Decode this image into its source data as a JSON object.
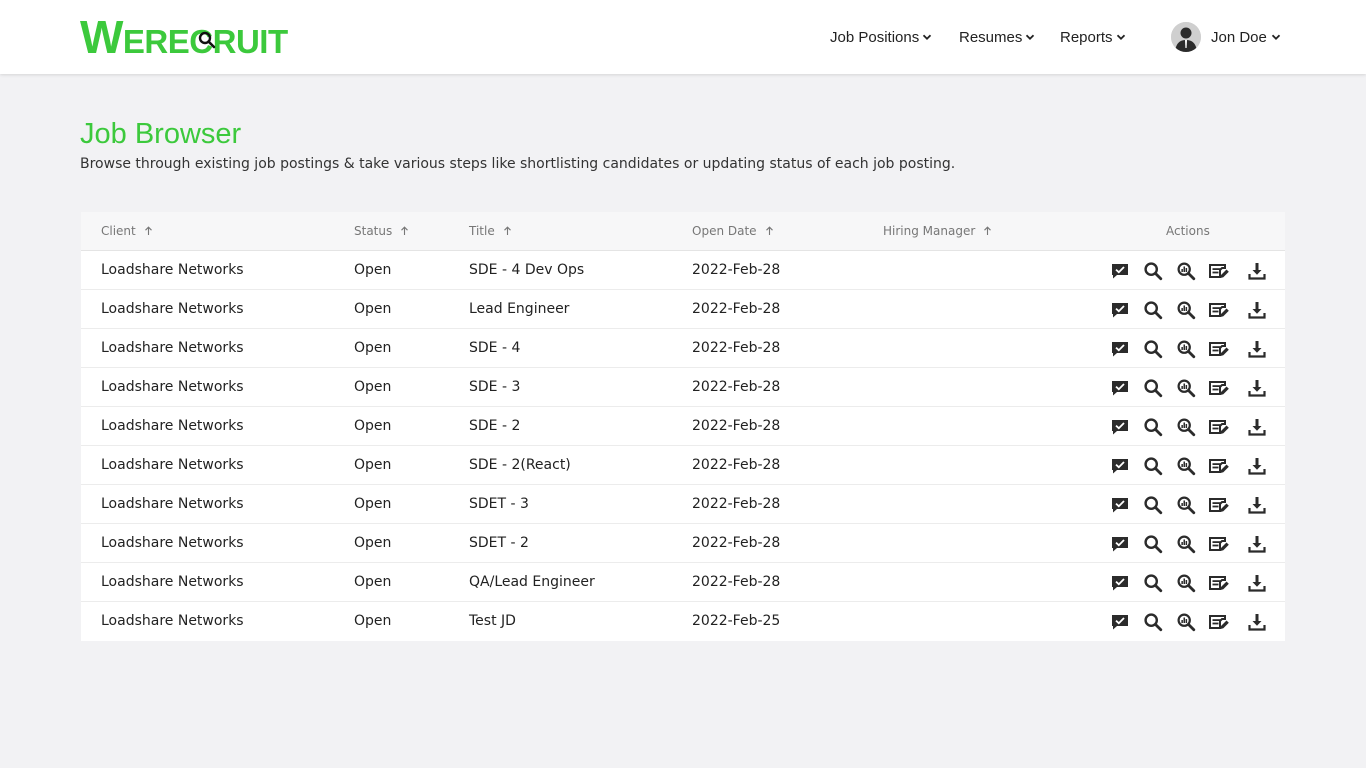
{
  "brand": {
    "logo_text": "WERECRUIT",
    "accent_color": "#3cc93c"
  },
  "nav": {
    "job_positions": "Job Positions",
    "resumes": "Resumes",
    "reports": "Reports"
  },
  "user": {
    "name": "Jon Doe"
  },
  "page": {
    "title": "Job Browser",
    "subtitle": "Browse through existing job postings & take various steps like shortlisting candidates or updating status of each job posting."
  },
  "table": {
    "headers": {
      "client": "Client",
      "status": "Status",
      "title": "Title",
      "open_date": "Open Date",
      "hiring_manager": "Hiring Manager",
      "actions": "Actions"
    },
    "action_icons": [
      "comment-check-icon",
      "search-icon",
      "analytics-search-icon",
      "edit-note-icon",
      "download-icon"
    ],
    "rows": [
      {
        "client": "Loadshare Networks",
        "status": "Open",
        "title": "SDE - 4 Dev Ops",
        "open_date": "2022-Feb-28",
        "hiring_manager": ""
      },
      {
        "client": "Loadshare Networks",
        "status": "Open",
        "title": "Lead Engineer",
        "open_date": "2022-Feb-28",
        "hiring_manager": ""
      },
      {
        "client": "Loadshare Networks",
        "status": "Open",
        "title": "SDE - 4",
        "open_date": "2022-Feb-28",
        "hiring_manager": ""
      },
      {
        "client": "Loadshare Networks",
        "status": "Open",
        "title": "SDE - 3",
        "open_date": "2022-Feb-28",
        "hiring_manager": ""
      },
      {
        "client": "Loadshare Networks",
        "status": "Open",
        "title": "SDE - 2",
        "open_date": "2022-Feb-28",
        "hiring_manager": ""
      },
      {
        "client": "Loadshare Networks",
        "status": "Open",
        "title": "SDE - 2(React)",
        "open_date": "2022-Feb-28",
        "hiring_manager": ""
      },
      {
        "client": "Loadshare Networks",
        "status": "Open",
        "title": "SDET - 3",
        "open_date": "2022-Feb-28",
        "hiring_manager": ""
      },
      {
        "client": "Loadshare Networks",
        "status": "Open",
        "title": "SDET - 2",
        "open_date": "2022-Feb-28",
        "hiring_manager": ""
      },
      {
        "client": "Loadshare Networks",
        "status": "Open",
        "title": "QA/Lead Engineer",
        "open_date": "2022-Feb-28",
        "hiring_manager": ""
      },
      {
        "client": "Loadshare Networks",
        "status": "Open",
        "title": "Test JD",
        "open_date": "2022-Feb-25",
        "hiring_manager": ""
      }
    ]
  }
}
